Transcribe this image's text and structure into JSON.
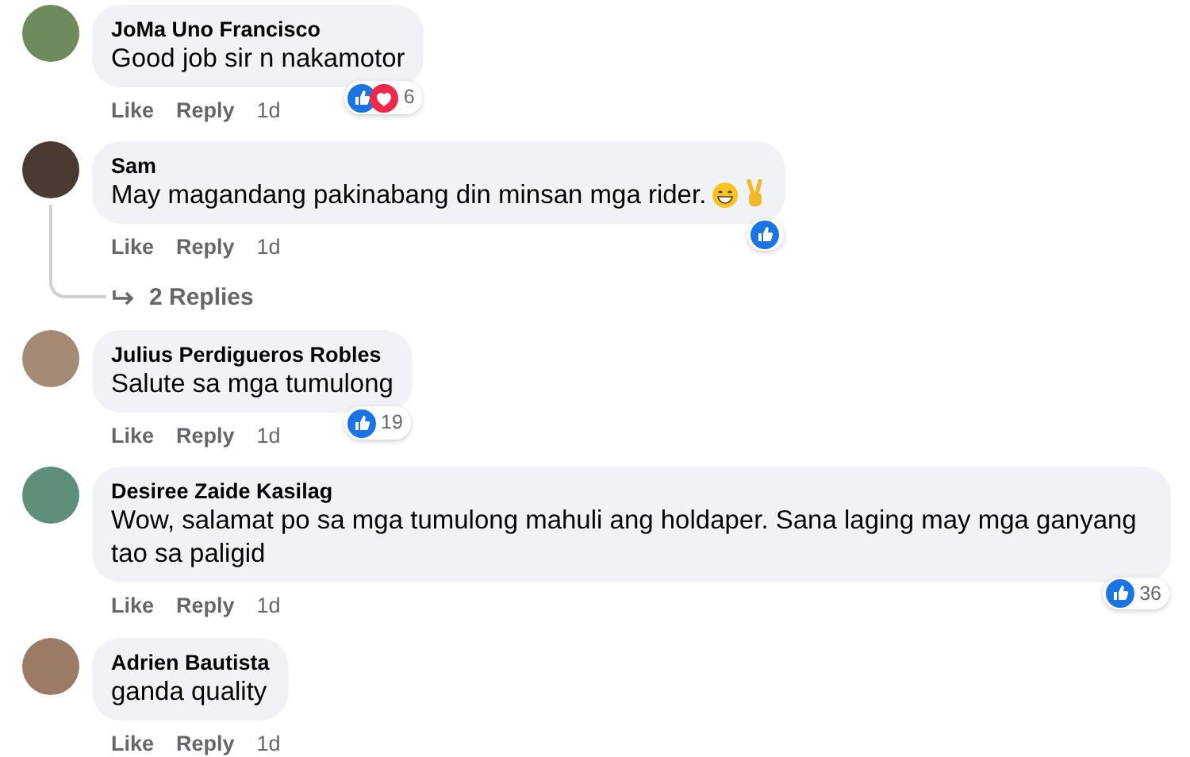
{
  "comments": [
    {
      "author": "JoMa Uno Francisco",
      "text": "Good job sir n nakamotor",
      "reactions": [
        {
          "kind": "like"
        },
        {
          "kind": "love"
        }
      ],
      "reaction_count": "6",
      "actions": [
        "Like",
        "Reply"
      ],
      "time": "1d"
    },
    {
      "author": "Sam",
      "text": "May magandang pakinabang din minsan mga rider.",
      "emoji": [
        {
          "kind": "grin"
        },
        {
          "kind": "peace"
        }
      ],
      "reactions": [
        {
          "kind": "like"
        }
      ],
      "actions": [
        "Like",
        "Reply"
      ],
      "time": "1d",
      "replies": "2 Replies"
    },
    {
      "author": "Julius Perdigueros Robles",
      "text": "Salute sa mga tumulong",
      "reactions": [
        {
          "kind": "like"
        }
      ],
      "reaction_count": "19",
      "actions": [
        "Like",
        "Reply"
      ],
      "time": "1d"
    },
    {
      "author": "Desiree Zaide Kasilag",
      "text": "Wow, salamat po sa mga tumulong mahuli ang holdaper. Sana laging may mga ganyang tao sa paligid",
      "reactions": [
        {
          "kind": "like"
        }
      ],
      "reaction_count": "36",
      "actions": [
        "Like",
        "Reply"
      ],
      "time": "1d"
    },
    {
      "author": "Adrien Bautista",
      "text": "ganda quality",
      "actions": [
        "Like",
        "Reply"
      ],
      "time": "1d"
    }
  ]
}
